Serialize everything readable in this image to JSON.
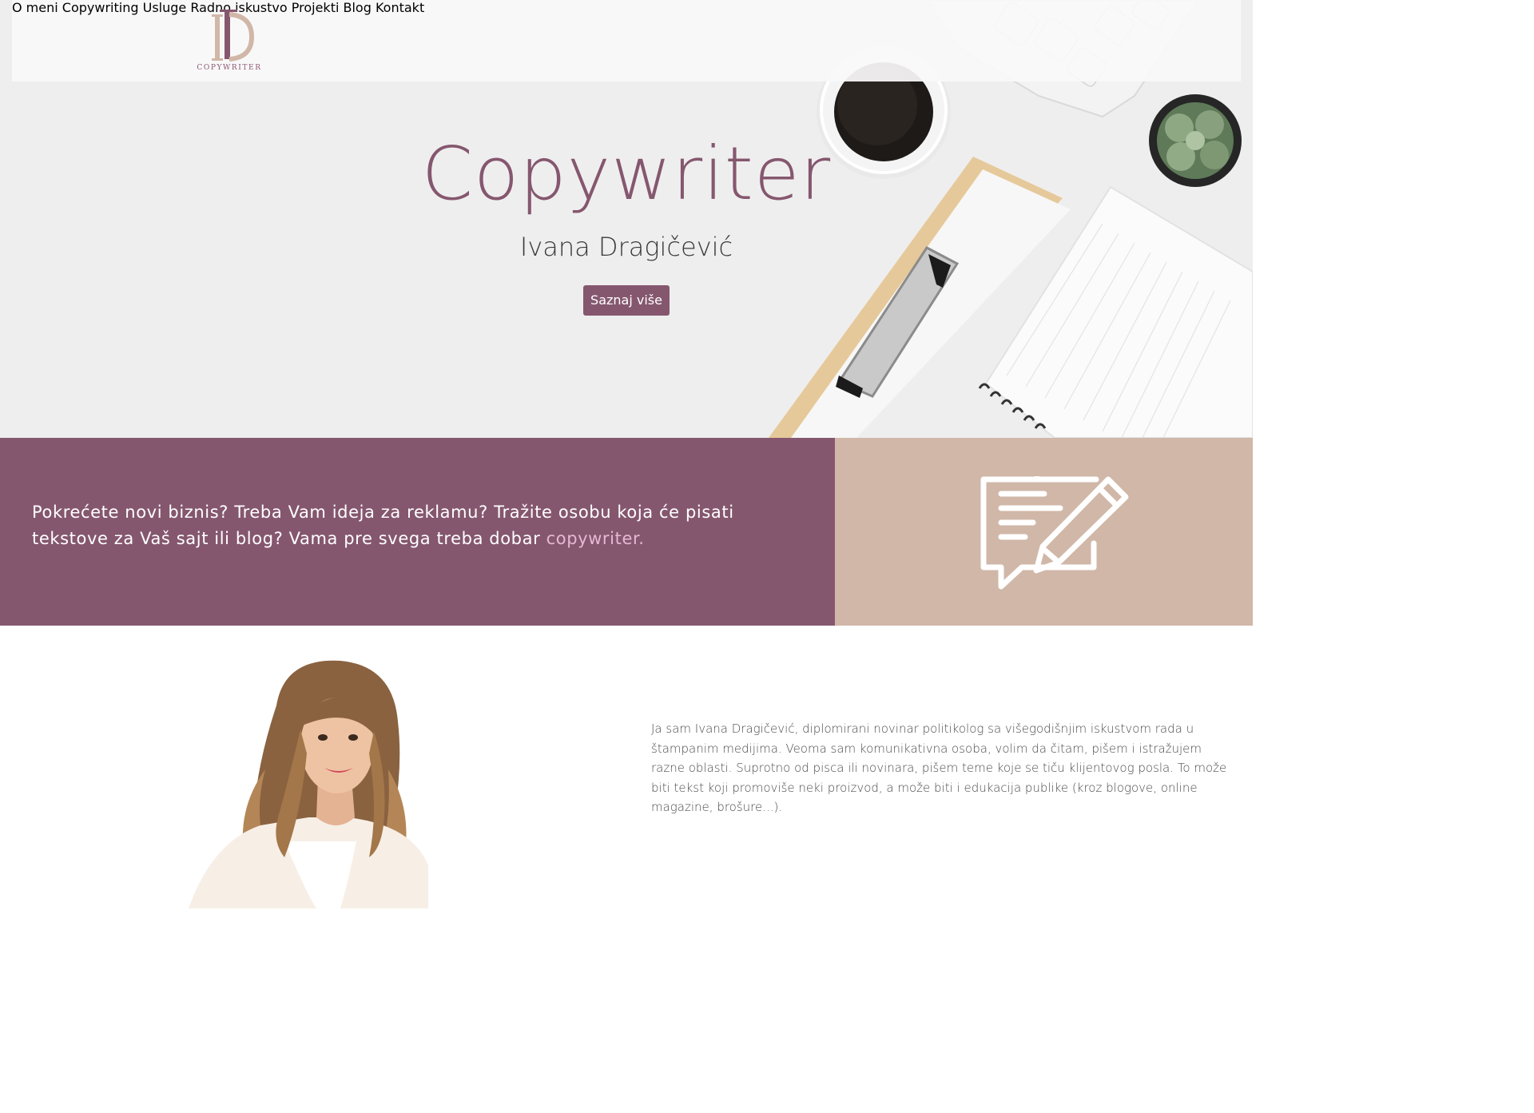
{
  "brand": {
    "logo_text": "COPYWRITER"
  },
  "nav": {
    "items": [
      {
        "label": "O meni"
      },
      {
        "label": "Copywriting"
      },
      {
        "label": "Usluge"
      },
      {
        "label": "Radno iskustvo"
      },
      {
        "label": "Projekti"
      },
      {
        "label": "Blog"
      },
      {
        "label": "Kontakt"
      }
    ]
  },
  "hero": {
    "title": "Copywriter",
    "subtitle": "Ivana Dragičević",
    "cta_label": "Saznaj više"
  },
  "band": {
    "text": "Pokrećete novi biznis? Treba Vam ideja za reklamu? Tražite osobu koja će pisati tekstove za Vaš sajt ili blog? Vama pre svega treba dobar ",
    "accent": "copywriter."
  },
  "about": {
    "text": "Ja sam Ivana Dragičević, diplomirani novinar politikolog sa višegodišnjim iskustvom rada u štampanim medijima. Veoma sam komunikativna osoba, volim da čitam, pišem i istražujem razne oblasti. Suprotno od pisca ili novinara, pišem teme koje se tiču klijentovog posla. To može biti tekst koji promoviše neki proizvod, a može biti i edukacija publike (kroz blogove, online magazine, brošure...)."
  },
  "colors": {
    "primary": "#85576f",
    "accent_light": "#e6b8d4",
    "beige": "#d0b7a8",
    "hero_bg": "#efeeee"
  },
  "icons": [
    "logo-monogram-icon",
    "write-message-icon"
  ]
}
